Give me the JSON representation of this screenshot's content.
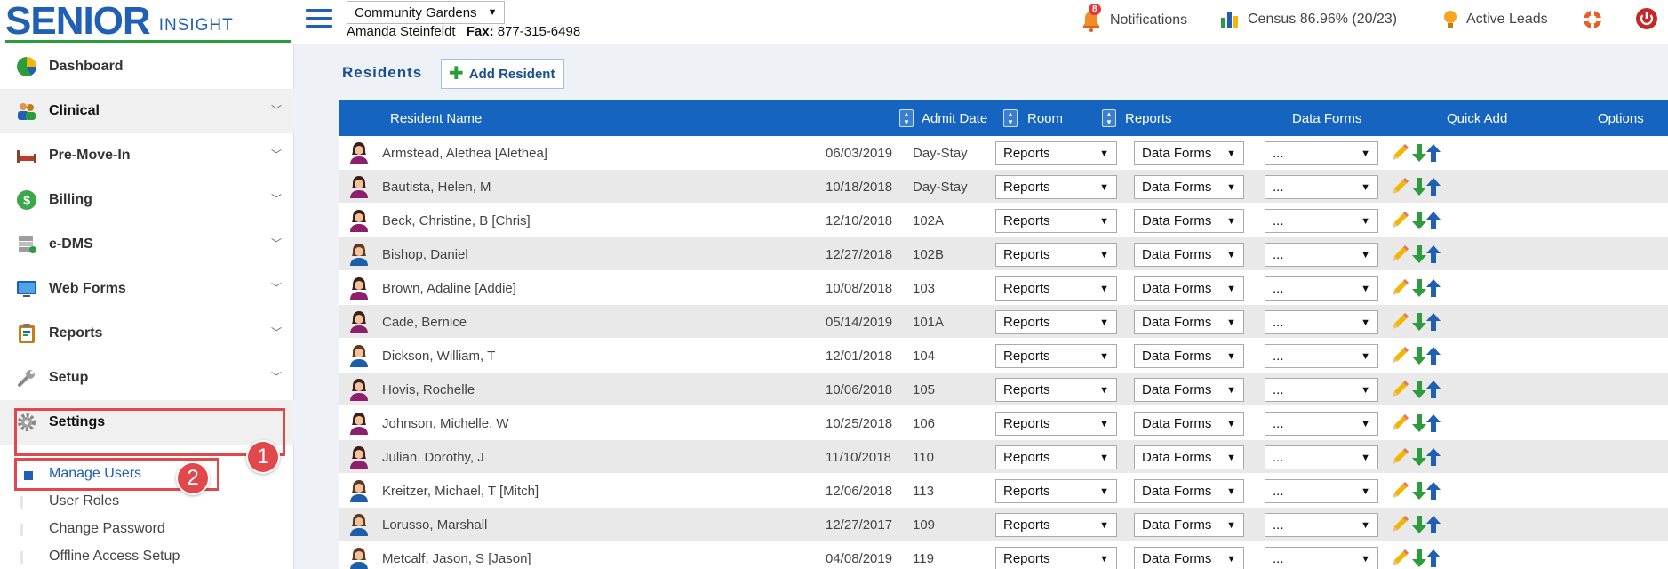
{
  "brand": {
    "name": "SENIOR",
    "sub": "INSIGHT"
  },
  "header": {
    "community": "Community Gardens",
    "user_name": "Amanda Steinfeldt",
    "fax_label": "Fax:",
    "fax_number": "877-315-6498",
    "notifications_label": "Notifications",
    "notifications_count": "8",
    "census_label": "Census 86.96% (20/23)",
    "leads_label": "Active Leads"
  },
  "sidebar": {
    "items": [
      {
        "label": "Dashboard"
      },
      {
        "label": "Clinical"
      },
      {
        "label": "Pre-Move-In"
      },
      {
        "label": "Billing"
      },
      {
        "label": "e-DMS"
      },
      {
        "label": "Web Forms"
      },
      {
        "label": "Reports"
      },
      {
        "label": "Setup"
      },
      {
        "label": "Settings"
      }
    ],
    "settings_sub": [
      {
        "label": "Manage Users"
      },
      {
        "label": "User Roles"
      },
      {
        "label": "Change Password"
      },
      {
        "label": "Offline Access Setup"
      }
    ]
  },
  "callouts": {
    "one": "1",
    "two": "2"
  },
  "main": {
    "title": "Residents",
    "add_button": "Add Resident",
    "columns": {
      "name": "Resident Name",
      "admit": "Admit Date",
      "room": "Room",
      "reports": "Reports",
      "forms": "Data Forms",
      "quick": "Quick Add",
      "options": "Options"
    },
    "select_defaults": {
      "reports": "Reports",
      "forms": "Data Forms",
      "quick": "..."
    },
    "rows": [
      {
        "name": "Armstead, Alethea [Alethea]",
        "admit": "06/03/2019",
        "room": "Day-Stay",
        "gender": "female"
      },
      {
        "name": "Bautista, Helen, M",
        "admit": "10/18/2018",
        "room": "Day-Stay",
        "gender": "female"
      },
      {
        "name": "Beck, Christine, B [Chris]",
        "admit": "12/10/2018",
        "room": "102A",
        "gender": "female"
      },
      {
        "name": "Bishop, Daniel",
        "admit": "12/27/2018",
        "room": "102B",
        "gender": "male"
      },
      {
        "name": "Brown, Adaline [Addie]",
        "admit": "10/08/2018",
        "room": "103",
        "gender": "female"
      },
      {
        "name": "Cade, Bernice",
        "admit": "05/14/2019",
        "room": "101A",
        "gender": "female"
      },
      {
        "name": "Dickson, William, T",
        "admit": "12/01/2018",
        "room": "104",
        "gender": "male"
      },
      {
        "name": "Hovis, Rochelle",
        "admit": "10/06/2018",
        "room": "105",
        "gender": "female"
      },
      {
        "name": "Johnson, Michelle, W",
        "admit": "10/25/2018",
        "room": "106",
        "gender": "female"
      },
      {
        "name": "Julian, Dorothy, J",
        "admit": "11/10/2018",
        "room": "110",
        "gender": "female"
      },
      {
        "name": "Kreitzer, Michael, T [Mitch]",
        "admit": "12/06/2018",
        "room": "113",
        "gender": "male"
      },
      {
        "name": "Lorusso, Marshall",
        "admit": "12/27/2017",
        "room": "109",
        "gender": "male"
      },
      {
        "name": "Metcalf, Jason, S [Jason]",
        "admit": "04/08/2019",
        "room": "119",
        "gender": "male"
      }
    ]
  },
  "colors": {
    "brand_blue": "#1f5fb4",
    "header_blue": "#1565c0",
    "callout_red": "#e2474b",
    "female_avatar": "#8e1f6b",
    "male_avatar": "#1c5fa8"
  }
}
